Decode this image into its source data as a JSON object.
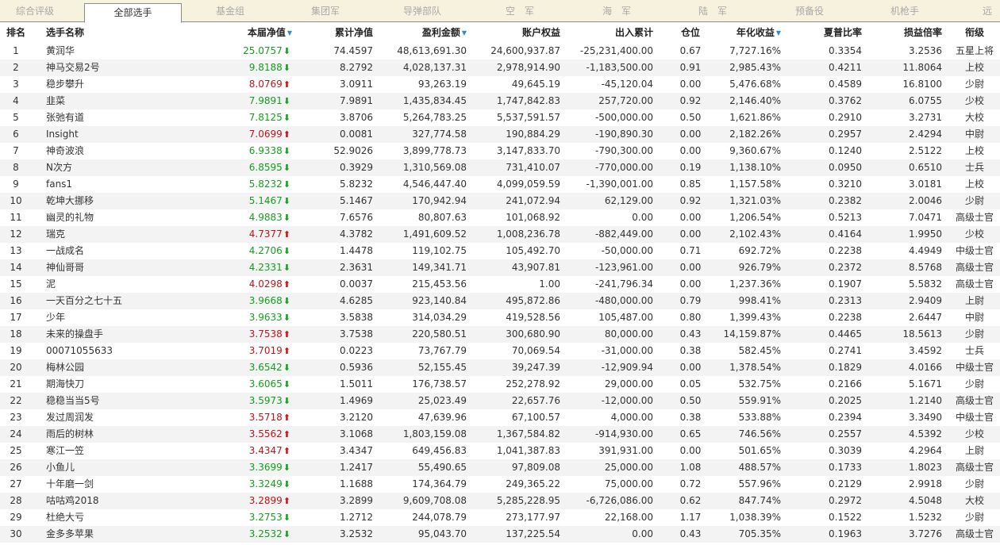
{
  "tabs": [
    {
      "label": "综合评级",
      "active": false
    },
    {
      "label": "全部选手",
      "active": true
    },
    {
      "label": "基金组",
      "active": false
    },
    {
      "label": "集团军",
      "active": false
    },
    {
      "label": "导弹部队",
      "active": false
    },
    {
      "label": "空　军",
      "active": false
    },
    {
      "label": "海　军",
      "active": false
    },
    {
      "label": "陆　军",
      "active": false
    },
    {
      "label": "预备役",
      "active": false
    },
    {
      "label": "机枪手",
      "active": false
    },
    {
      "label": "远",
      "active": false
    }
  ],
  "headers": {
    "rank": "排名",
    "name": "选手名称",
    "nav": "本届净值",
    "cum_nav": "累计净值",
    "profit": "盈利金额",
    "equity": "账户权益",
    "inout": "出入累计",
    "position": "仓位",
    "annual": "年化收益",
    "sharpe": "夏普比率",
    "pl_ratio": "损益倍率",
    "rank_title": "衔级"
  },
  "sort_icon": "sort-descending-icon",
  "colors": {
    "up": "#c4141b",
    "down": "#14a01e",
    "sort": "#2a8ad8"
  },
  "rows": [
    {
      "rank": "1",
      "name": "黄润华",
      "nav": "25.0757",
      "dir": "down",
      "cum_nav": "74.4597",
      "profit": "48,613,691.30",
      "equity": "24,600,937.87",
      "inout": "-25,231,400.00",
      "position": "0.67",
      "annual": "7,727.16%",
      "sharpe": "0.3354",
      "pl_ratio": "3.2536",
      "title": "五星上将"
    },
    {
      "rank": "2",
      "name": "神马交易2号",
      "nav": "9.8188",
      "dir": "down",
      "cum_nav": "8.2792",
      "profit": "4,028,137.31",
      "equity": "2,978,914.90",
      "inout": "-1,183,500.00",
      "position": "0.91",
      "annual": "2,985.43%",
      "sharpe": "0.4211",
      "pl_ratio": "11.8064",
      "title": "上校"
    },
    {
      "rank": "3",
      "name": "稳步攀升",
      "nav": "8.0769",
      "dir": "up",
      "cum_nav": "3.0911",
      "profit": "93,263.19",
      "equity": "49,645.19",
      "inout": "-45,120.04",
      "position": "0.00",
      "annual": "5,476.68%",
      "sharpe": "0.4589",
      "pl_ratio": "16.8100",
      "title": "少尉"
    },
    {
      "rank": "4",
      "name": "韭菜",
      "nav": "7.9891",
      "dir": "down",
      "cum_nav": "7.9891",
      "profit": "1,435,834.45",
      "equity": "1,747,842.83",
      "inout": "257,720.00",
      "position": "0.92",
      "annual": "2,146.40%",
      "sharpe": "0.3762",
      "pl_ratio": "6.0755",
      "title": "少校"
    },
    {
      "rank": "5",
      "name": "张弛有道",
      "nav": "7.8125",
      "dir": "down",
      "cum_nav": "3.8706",
      "profit": "5,264,783.25",
      "equity": "5,537,591.57",
      "inout": "-500,000.00",
      "position": "0.50",
      "annual": "1,621.86%",
      "sharpe": "0.2910",
      "pl_ratio": "3.2731",
      "title": "大校"
    },
    {
      "rank": "6",
      "name": "Insight",
      "nav": "7.0699",
      "dir": "up",
      "cum_nav": "0.0081",
      "profit": "327,774.58",
      "equity": "190,884.29",
      "inout": "-190,890.30",
      "position": "0.00",
      "annual": "2,182.26%",
      "sharpe": "0.2957",
      "pl_ratio": "2.4294",
      "title": "中尉"
    },
    {
      "rank": "7",
      "name": "神奇波浪",
      "nav": "6.9338",
      "dir": "down",
      "cum_nav": "52.9026",
      "profit": "3,899,778.73",
      "equity": "3,147,833.70",
      "inout": "-790,300.00",
      "position": "0.00",
      "annual": "9,360.67%",
      "sharpe": "0.1240",
      "pl_ratio": "2.5122",
      "title": "上校"
    },
    {
      "rank": "8",
      "name": "N次方",
      "nav": "6.8595",
      "dir": "down",
      "cum_nav": "0.3929",
      "profit": "1,310,569.08",
      "equity": "731,410.07",
      "inout": "-770,000.00",
      "position": "0.19",
      "annual": "1,138.10%",
      "sharpe": "0.0950",
      "pl_ratio": "0.6510",
      "title": "士兵"
    },
    {
      "rank": "9",
      "name": "fans1",
      "nav": "5.8232",
      "dir": "down",
      "cum_nav": "5.8232",
      "profit": "4,546,447.40",
      "equity": "4,099,059.59",
      "inout": "-1,390,001.00",
      "position": "0.85",
      "annual": "1,157.58%",
      "sharpe": "0.3210",
      "pl_ratio": "3.0181",
      "title": "上校"
    },
    {
      "rank": "10",
      "name": "乾坤大挪移",
      "nav": "5.1467",
      "dir": "down",
      "cum_nav": "5.1467",
      "profit": "170,942.94",
      "equity": "241,072.94",
      "inout": "62,129.00",
      "position": "0.92",
      "annual": "1,321.03%",
      "sharpe": "0.2382",
      "pl_ratio": "2.0046",
      "title": "少尉"
    },
    {
      "rank": "11",
      "name": "幽灵的礼物",
      "nav": "4.9883",
      "dir": "down",
      "cum_nav": "7.6576",
      "profit": "80,807.63",
      "equity": "101,068.92",
      "inout": "0.00",
      "position": "0.00",
      "annual": "1,206.54%",
      "sharpe": "0.5213",
      "pl_ratio": "7.0471",
      "title": "高级士官"
    },
    {
      "rank": "12",
      "name": "瑞克",
      "nav": "4.7377",
      "dir": "up",
      "cum_nav": "4.3782",
      "profit": "1,491,609.52",
      "equity": "1,008,236.78",
      "inout": "-882,449.00",
      "position": "0.00",
      "annual": "2,102.43%",
      "sharpe": "0.4164",
      "pl_ratio": "1.9950",
      "title": "少校"
    },
    {
      "rank": "13",
      "name": "一战成名",
      "nav": "4.2706",
      "dir": "down",
      "cum_nav": "1.4478",
      "profit": "119,102.75",
      "equity": "105,492.70",
      "inout": "-50,000.00",
      "position": "0.71",
      "annual": "692.72%",
      "sharpe": "0.2238",
      "pl_ratio": "4.4949",
      "title": "中级士官"
    },
    {
      "rank": "14",
      "name": "神仙哥哥",
      "nav": "4.2331",
      "dir": "down",
      "cum_nav": "2.3631",
      "profit": "149,341.71",
      "equity": "43,907.81",
      "inout": "-123,961.00",
      "position": "0.00",
      "annual": "926.79%",
      "sharpe": "0.2372",
      "pl_ratio": "8.5768",
      "title": "高级士官"
    },
    {
      "rank": "15",
      "name": "泥",
      "nav": "4.0298",
      "dir": "up",
      "cum_nav": "0.0037",
      "profit": "215,453.56",
      "equity": "1.00",
      "inout": "-241,796.34",
      "position": "0.00",
      "annual": "1,237.36%",
      "sharpe": "0.1907",
      "pl_ratio": "5.5832",
      "title": "高级士官"
    },
    {
      "rank": "16",
      "name": "一天百分之七十五",
      "nav": "3.9668",
      "dir": "down",
      "cum_nav": "4.6285",
      "profit": "923,140.84",
      "equity": "495,872.86",
      "inout": "-480,000.00",
      "position": "0.79",
      "annual": "998.41%",
      "sharpe": "0.2313",
      "pl_ratio": "2.9409",
      "title": "上尉"
    },
    {
      "rank": "17",
      "name": "少年",
      "nav": "3.9633",
      "dir": "down",
      "cum_nav": "3.5838",
      "profit": "314,034.29",
      "equity": "419,528.56",
      "inout": "105,487.00",
      "position": "0.80",
      "annual": "1,399.43%",
      "sharpe": "0.2238",
      "pl_ratio": "2.6447",
      "title": "中尉"
    },
    {
      "rank": "18",
      "name": "未来的操盘手",
      "nav": "3.7538",
      "dir": "up",
      "cum_nav": "3.7538",
      "profit": "220,580.51",
      "equity": "300,680.90",
      "inout": "80,000.00",
      "position": "0.43",
      "annual": "14,159.87%",
      "sharpe": "0.4465",
      "pl_ratio": "18.5613",
      "title": "少尉"
    },
    {
      "rank": "19",
      "name": "00071055633",
      "nav": "3.7019",
      "dir": "up",
      "cum_nav": "0.0223",
      "profit": "73,767.79",
      "equity": "70,069.54",
      "inout": "-31,000.00",
      "position": "0.38",
      "annual": "582.45%",
      "sharpe": "0.2741",
      "pl_ratio": "3.4592",
      "title": "士兵"
    },
    {
      "rank": "20",
      "name": "梅林公园",
      "nav": "3.6542",
      "dir": "down",
      "cum_nav": "0.5936",
      "profit": "52,155.45",
      "equity": "39,247.39",
      "inout": "-12,909.94",
      "position": "0.00",
      "annual": "1,378.54%",
      "sharpe": "0.1829",
      "pl_ratio": "4.0166",
      "title": "中级士官"
    },
    {
      "rank": "21",
      "name": "期海快刀",
      "nav": "3.6065",
      "dir": "down",
      "cum_nav": "1.5011",
      "profit": "176,738.57",
      "equity": "252,278.92",
      "inout": "29,000.00",
      "position": "0.05",
      "annual": "532.75%",
      "sharpe": "0.2166",
      "pl_ratio": "5.1671",
      "title": "少尉"
    },
    {
      "rank": "22",
      "name": "稳稳当当5号",
      "nav": "3.5973",
      "dir": "down",
      "cum_nav": "1.4969",
      "profit": "25,023.49",
      "equity": "22,657.76",
      "inout": "-12,000.00",
      "position": "0.50",
      "annual": "559.91%",
      "sharpe": "0.2025",
      "pl_ratio": "1.2140",
      "title": "高级士官"
    },
    {
      "rank": "23",
      "name": "发过周润发",
      "nav": "3.5718",
      "dir": "up",
      "cum_nav": "3.2120",
      "profit": "47,639.96",
      "equity": "67,100.57",
      "inout": "4,000.00",
      "position": "0.38",
      "annual": "533.88%",
      "sharpe": "0.2394",
      "pl_ratio": "3.3490",
      "title": "中级士官"
    },
    {
      "rank": "24",
      "name": "雨后的树林",
      "nav": "3.5562",
      "dir": "up",
      "cum_nav": "3.1068",
      "profit": "1,803,159.08",
      "equity": "1,367,584.82",
      "inout": "-914,930.00",
      "position": "0.65",
      "annual": "746.56%",
      "sharpe": "0.2557",
      "pl_ratio": "4.5392",
      "title": "少校"
    },
    {
      "rank": "25",
      "name": "寒江一笠",
      "nav": "3.4347",
      "dir": "up",
      "cum_nav": "3.4347",
      "profit": "649,456.83",
      "equity": "1,041,387.83",
      "inout": "391,931.00",
      "position": "0.00",
      "annual": "501.65%",
      "sharpe": "0.3039",
      "pl_ratio": "4.2964",
      "title": "上尉"
    },
    {
      "rank": "26",
      "name": "小鱼儿",
      "nav": "3.3699",
      "dir": "down",
      "cum_nav": "1.2417",
      "profit": "55,490.65",
      "equity": "97,809.08",
      "inout": "25,000.00",
      "position": "1.08",
      "annual": "488.57%",
      "sharpe": "0.1733",
      "pl_ratio": "1.8023",
      "title": "高级士官"
    },
    {
      "rank": "27",
      "name": "十年磨一剑",
      "nav": "3.3249",
      "dir": "down",
      "cum_nav": "1.1688",
      "profit": "174,364.79",
      "equity": "249,365.22",
      "inout": "75,000.00",
      "position": "0.72",
      "annual": "557.96%",
      "sharpe": "0.2129",
      "pl_ratio": "2.9918",
      "title": "少尉"
    },
    {
      "rank": "28",
      "name": "咕咕鸡2018",
      "nav": "3.2899",
      "dir": "up",
      "cum_nav": "3.2899",
      "profit": "9,609,708.08",
      "equity": "5,285,228.95",
      "inout": "-6,726,086.00",
      "position": "0.62",
      "annual": "847.74%",
      "sharpe": "0.2972",
      "pl_ratio": "4.5048",
      "title": "大校"
    },
    {
      "rank": "29",
      "name": "杜绝大亏",
      "nav": "3.2753",
      "dir": "down",
      "cum_nav": "1.2712",
      "profit": "244,078.79",
      "equity": "273,177.97",
      "inout": "22,168.00",
      "position": "1.17",
      "annual": "1,038.39%",
      "sharpe": "0.1522",
      "pl_ratio": "1.5232",
      "title": "少尉"
    },
    {
      "rank": "30",
      "name": "金多多苹果",
      "nav": "3.2532",
      "dir": "down",
      "cum_nav": "3.2532",
      "profit": "95,043.70",
      "equity": "137,225.54",
      "inout": "0.00",
      "position": "0.43",
      "annual": "705.35%",
      "sharpe": "0.1963",
      "pl_ratio": "3.7276",
      "title": "高级士官"
    }
  ]
}
